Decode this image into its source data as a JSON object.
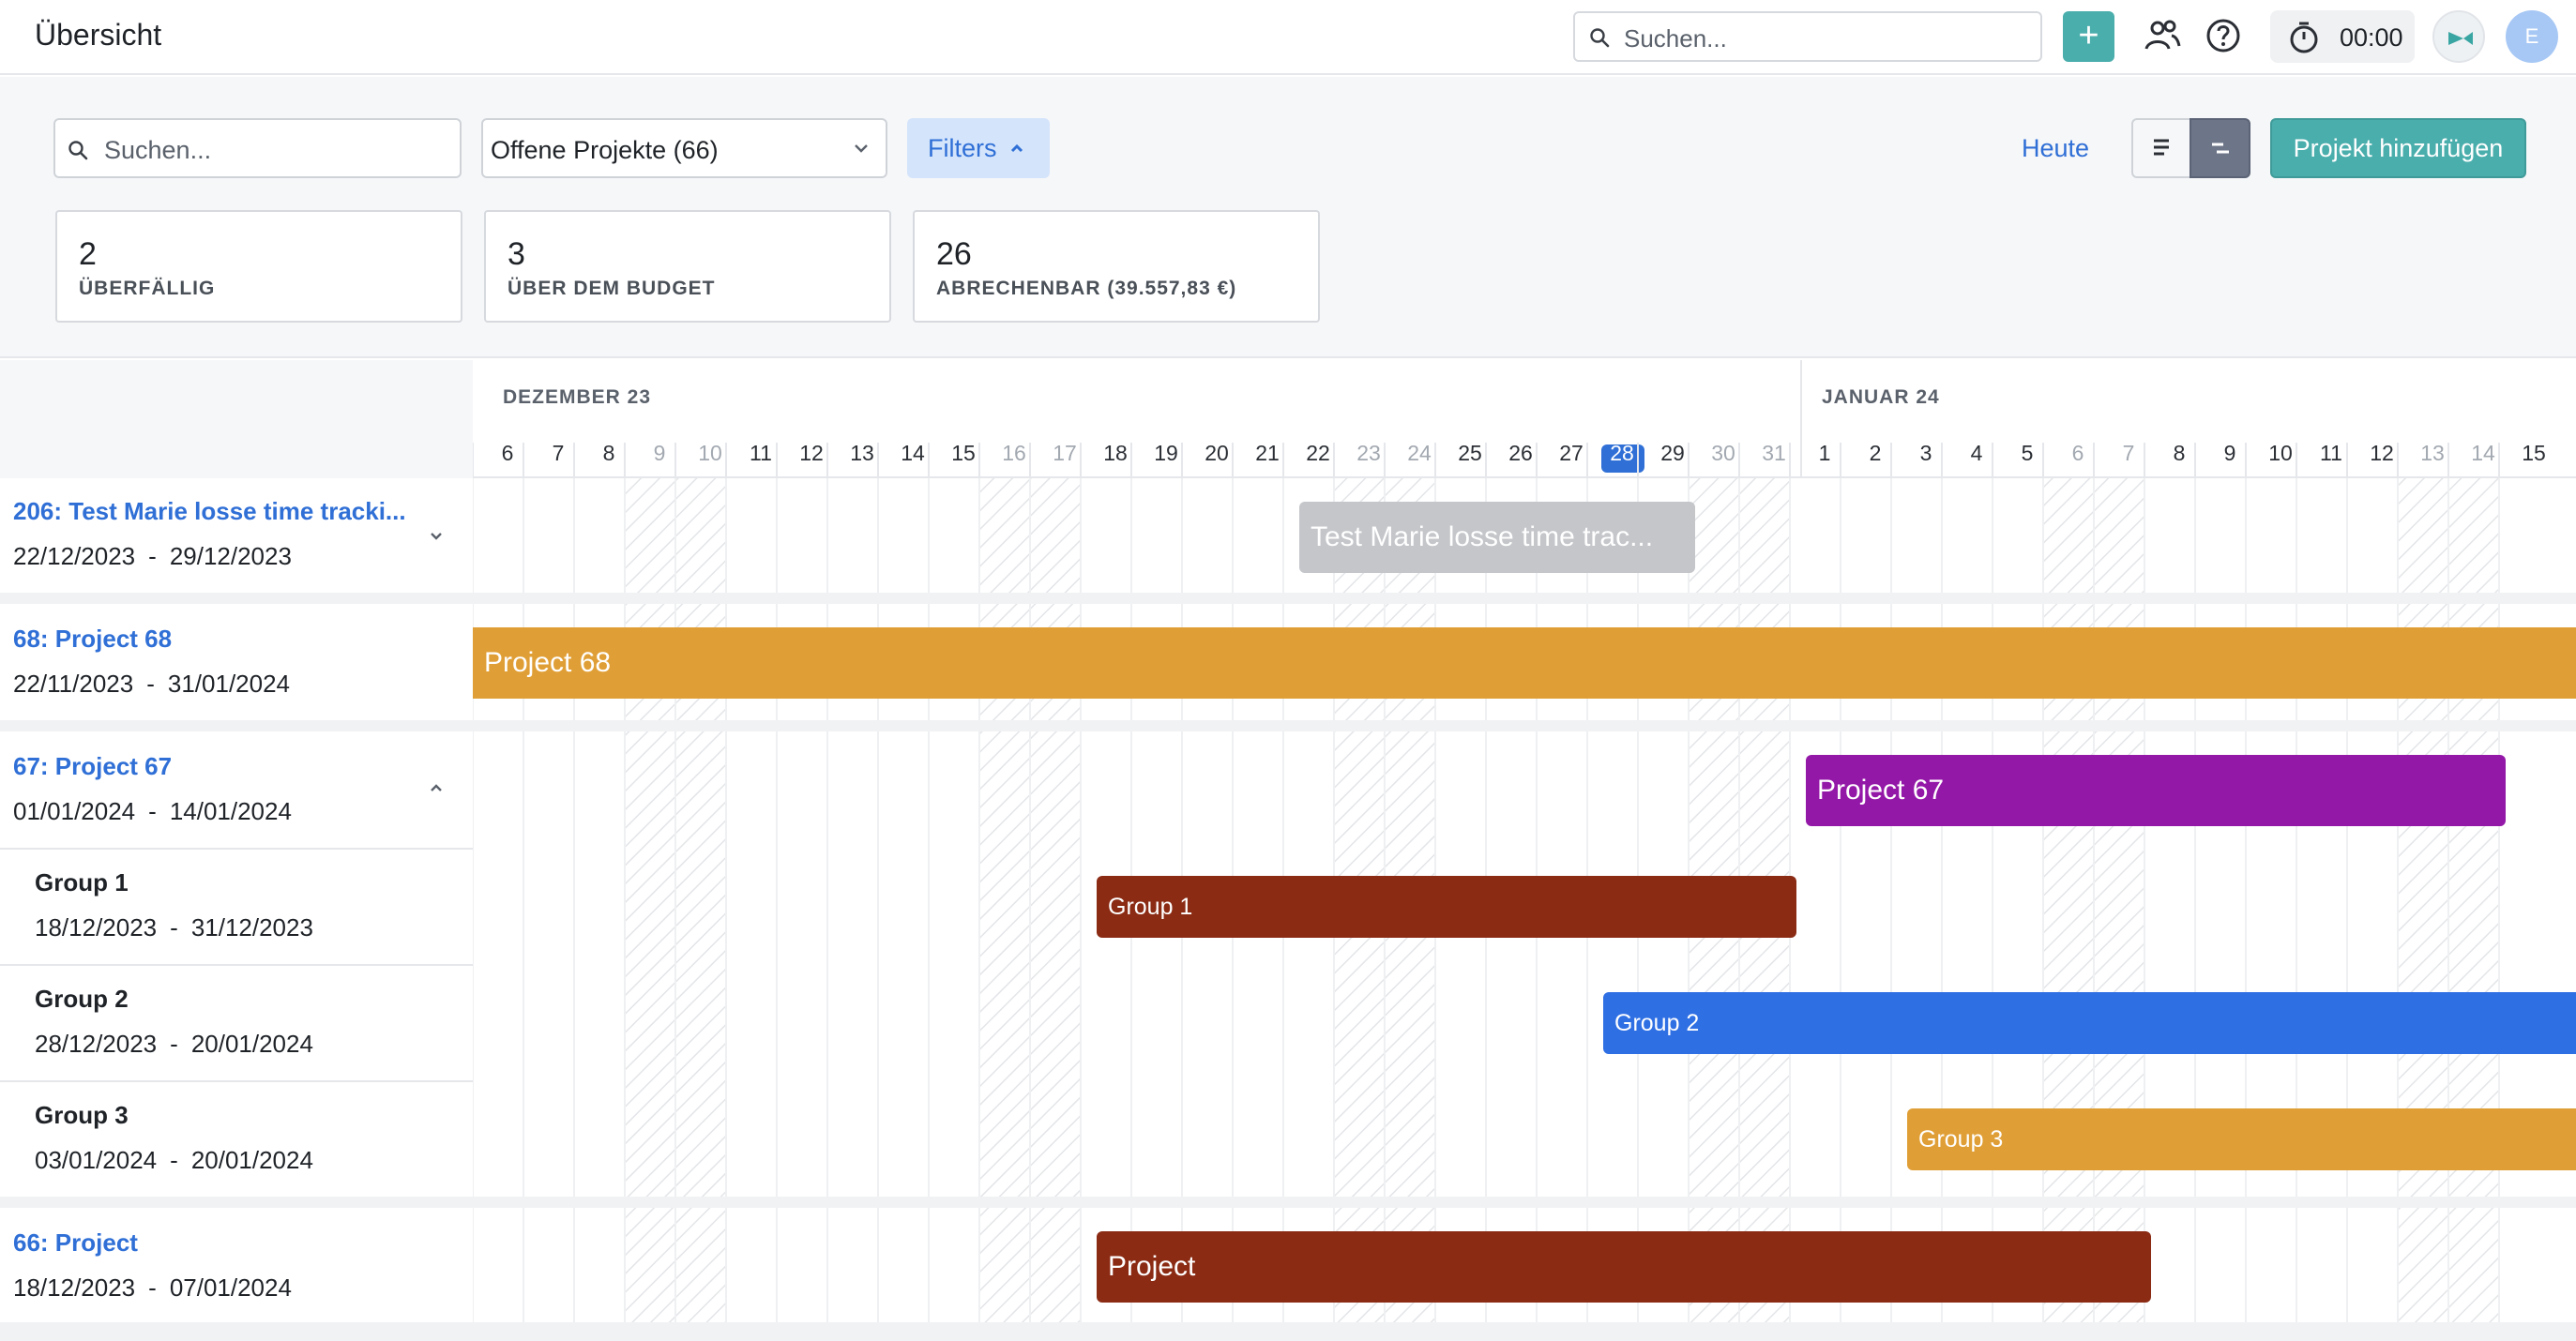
{
  "header": {
    "title": "Übersicht",
    "search_placeholder": "Suchen...",
    "timer": "00:00",
    "user_initial": "E"
  },
  "toolbar": {
    "search_placeholder": "Suchen...",
    "project_filter": "Offene Projekte (66)",
    "filters_label": "Filters",
    "today_label": "Heute",
    "add_project_label": "Projekt hinzufügen"
  },
  "stats": [
    {
      "value": "2",
      "label": "ÜBERFÄLLIG"
    },
    {
      "value": "3",
      "label": "ÜBER DEM BUDGET"
    },
    {
      "value": "26",
      "label": "ABRECHENBAR (39.557,83 €)"
    }
  ],
  "timeline": {
    "months": [
      "DEZEMBER 23",
      "JANUAR 24"
    ],
    "days": [
      "6",
      "7",
      "8",
      "9",
      "10",
      "11",
      "12",
      "13",
      "14",
      "15",
      "16",
      "17",
      "18",
      "19",
      "20",
      "21",
      "22",
      "23",
      "24",
      "25",
      "26",
      "27",
      "28",
      "29",
      "30",
      "31",
      "1",
      "2",
      "3",
      "4",
      "5",
      "6",
      "7",
      "8",
      "9",
      "10",
      "11",
      "12",
      "13",
      "14",
      "15"
    ],
    "weekend_days": [
      3,
      4,
      10,
      11,
      17,
      18,
      24,
      25,
      31,
      32,
      38,
      39
    ],
    "today_index": 22
  },
  "rows": [
    {
      "title": "206: Test Marie losse time tracki...",
      "start": "22/12/2023",
      "end": "29/12/2023",
      "bar_label": "Test Marie losse time trac...",
      "bar_color": "#c4c6ca"
    },
    {
      "title": "68: Project 68",
      "start": "22/11/2023",
      "end": "31/01/2024",
      "bar_label": "Project 68",
      "bar_color": "#e09f36"
    },
    {
      "title": "67: Project 67",
      "start": "01/01/2024",
      "end": "14/01/2024",
      "bar_label": "Project 67",
      "bar_color": "#9418a8"
    },
    {
      "title": "Group 1",
      "start": "18/12/2023",
      "end": "31/12/2023",
      "bar_label": "Group 1",
      "bar_color": "#8b2b14"
    },
    {
      "title": "Group 2",
      "start": "28/12/2023",
      "end": "20/01/2024",
      "bar_label": "Group 2",
      "bar_color": "#2f6fe4"
    },
    {
      "title": "Group 3",
      "start": "03/01/2024",
      "end": "20/01/2024",
      "bar_label": "Group 3",
      "bar_color": "#e09f36"
    },
    {
      "title": "66: Project",
      "start": "18/12/2023",
      "end": "07/01/2024",
      "bar_label": "Project",
      "bar_color": "#8b2b14"
    }
  ],
  "date_separator": "-"
}
